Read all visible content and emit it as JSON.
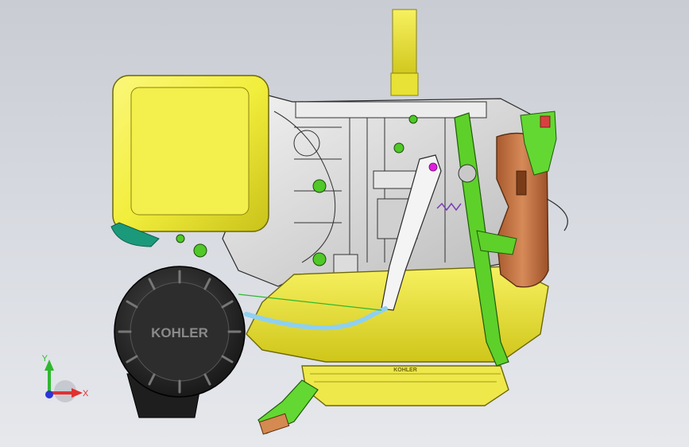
{
  "model": {
    "brand_text": "KOHLER",
    "oil_pan_text": "KOHLER"
  },
  "triad": {
    "y_label": "Y",
    "x_label": "X"
  },
  "colors": {
    "background_top": "#c9ccd3",
    "background_bottom": "#e6e8ec",
    "fuel_tank": "#f2ee3c",
    "shroud_yellow": "#f0ea2a",
    "engine_grey": "#d8d8d8",
    "lever_green": "#5ed02a",
    "muffler_copper": "#c27040",
    "air_cleaner": "#2b2b2b",
    "pipe_blue": "#8fd0f0",
    "arm_white": "#f4f4f4",
    "axis_x": "#e23030",
    "axis_y": "#2fb82f",
    "axis_z": "#2b35d8"
  },
  "icons": {
    "orientation_triad": "xyz-axis-triad-icon"
  }
}
